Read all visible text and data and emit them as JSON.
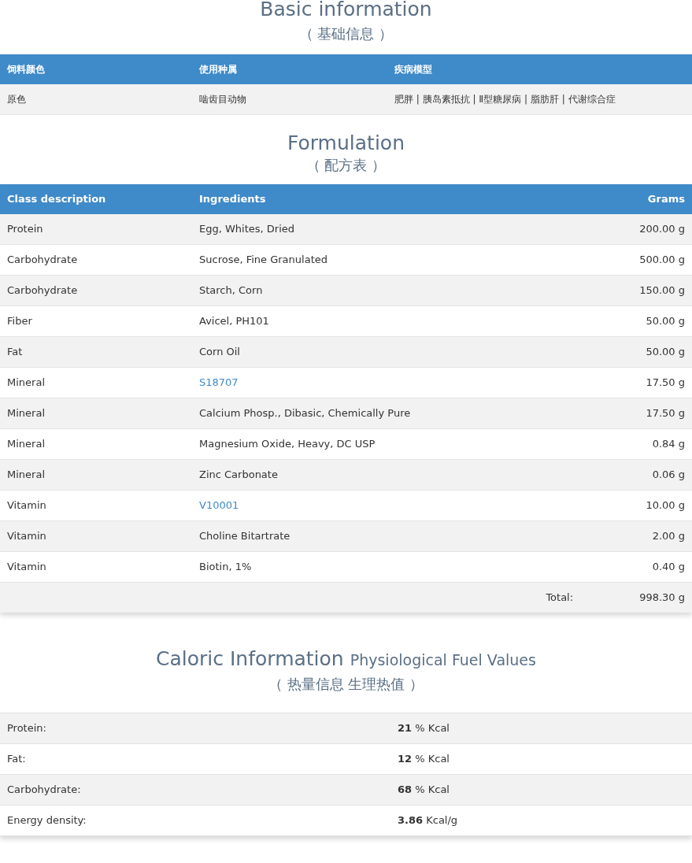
{
  "basic": {
    "title": "Basic information",
    "subtitle": "（ 基础信息 ）",
    "columns": [
      "饲料颜色",
      "使用种属",
      "疾病模型"
    ],
    "rows": [
      [
        "原色",
        "啮齿目动物",
        "肥胖 | 胰岛素抵抗 | Ⅱ型糖尿病 | 脂肪肝 | 代谢综合症"
      ]
    ]
  },
  "formulation": {
    "title": "Formulation",
    "subtitle": "（ 配方表 ）",
    "columns": [
      "Class description",
      "Ingredients",
      "Grams"
    ],
    "rows": [
      {
        "class": "Protein",
        "ingredient": "Egg, Whites, Dried",
        "link": false,
        "grams": "200.00 g"
      },
      {
        "class": "Carbohydrate",
        "ingredient": "Sucrose, Fine Granulated",
        "link": false,
        "grams": "500.00 g"
      },
      {
        "class": "Carbohydrate",
        "ingredient": "Starch, Corn",
        "link": false,
        "grams": "150.00 g"
      },
      {
        "class": "Fiber",
        "ingredient": "Avicel, PH101",
        "link": false,
        "grams": "50.00 g"
      },
      {
        "class": "Fat",
        "ingredient": "Corn Oil",
        "link": false,
        "grams": "50.00 g"
      },
      {
        "class": "Mineral",
        "ingredient": "S18707",
        "link": true,
        "grams": "17.50 g"
      },
      {
        "class": "Mineral",
        "ingredient": "Calcium Phosp., Dibasic, Chemically Pure",
        "link": false,
        "grams": "17.50 g"
      },
      {
        "class": "Mineral",
        "ingredient": "Magnesium Oxide, Heavy, DC USP",
        "link": false,
        "grams": "0.84 g"
      },
      {
        "class": "Mineral",
        "ingredient": "Zinc Carbonate",
        "link": false,
        "grams": "0.06 g"
      },
      {
        "class": "Vitamin",
        "ingredient": "V10001",
        "link": true,
        "grams": "10.00 g"
      },
      {
        "class": "Vitamin",
        "ingredient": "Choline Bitartrate",
        "link": false,
        "grams": "2.00 g"
      },
      {
        "class": "Vitamin",
        "ingredient": "Biotin, 1%",
        "link": false,
        "grams": "0.40 g"
      }
    ],
    "total_label": "Total:",
    "total": "998.30 g"
  },
  "caloric": {
    "title": "Caloric Information",
    "title_note": "Physiological Fuel Values",
    "subtitle": "（ 热量信息 生理热值 ）",
    "rows": [
      {
        "label": "Protein:",
        "value": "**21** % Kcal"
      },
      {
        "label": "Fat:",
        "value": "**12** % Kcal"
      },
      {
        "label": "Carbohydrate:",
        "value": "**68** % Kcal"
      },
      {
        "label": "Energy density:",
        "value": "**3.86** Kcal/g"
      }
    ]
  }
}
